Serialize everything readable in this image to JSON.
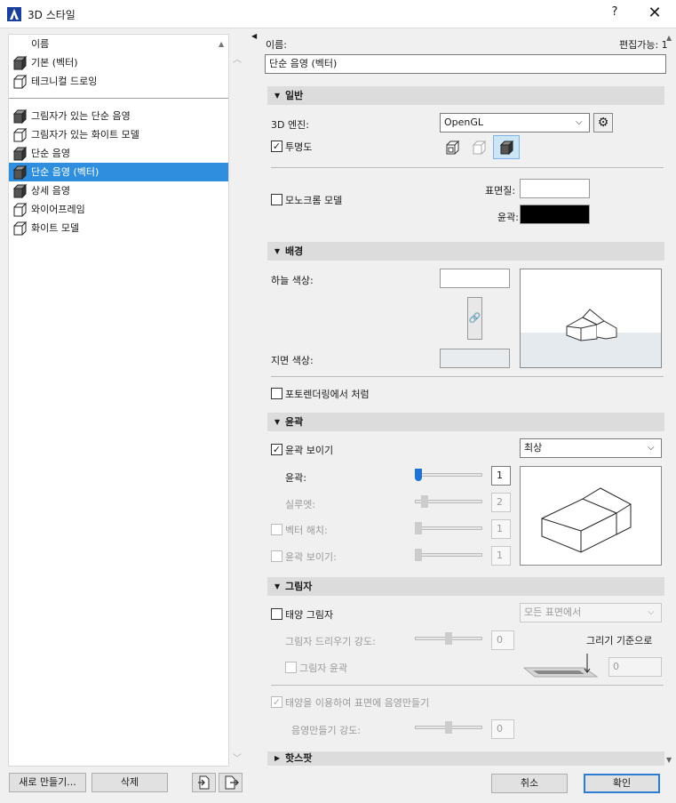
{
  "window": {
    "title": "3D 스타일",
    "help": "?",
    "close": "✕"
  },
  "list": {
    "header": "이름",
    "top_items": [
      "기본 (벡터)",
      "테크니컬 드로잉"
    ],
    "items": [
      "그림자가 있는 단순 음영",
      "그림자가 있는 화이트 모델",
      "단순 음영",
      "단순 음영 (벡터)",
      "상세 음영",
      "와이어프레임",
      "화이트 모델"
    ],
    "selected_index": 3
  },
  "left_buttons": {
    "new": "새로 만들기...",
    "delete": "삭제"
  },
  "name": {
    "label": "이름:",
    "editable": "편집가능: 1",
    "value": "단순 음영 (벡터)"
  },
  "general": {
    "title": "일반",
    "engine_label": "3D 엔진:",
    "engine_value": "OpenGL",
    "transparency_label": "투명도",
    "monochrome_label": "모노크롬 모델",
    "surface_label": "표면질:",
    "contour_label": "윤곽:"
  },
  "background": {
    "title": "배경",
    "sky_label": "하늘 색상:",
    "ground_label": "지면 색상:"
  },
  "photo_render_label": "포토렌더링에서 처럼",
  "contours": {
    "title": "윤곽",
    "show_label": "윤곽 보이기",
    "quality": "최상",
    "contour_label": "윤곽:",
    "contour_value": "1",
    "silhouette_label": "실루엣:",
    "silhouette_value": "2",
    "vector_hatch_label": "벡터 해치:",
    "vector_hatch_value": "1",
    "show2_label": "윤곽 보이기:",
    "show2_value": "1"
  },
  "shadows": {
    "title": "그림자",
    "sun_label": "태양 그림자",
    "surface_option": "모든 표면에서",
    "intensity_label": "그림자 드리우기 강도:",
    "intensity_value": "0",
    "draw_from": "그리기 기준으로",
    "outline_label": "그림자 윤곽",
    "level_value": "0",
    "sun_shading_label": "태양을 이용하여 표면에 음영만들기",
    "shading_intensity_label": "음영만들기 강도:",
    "shading_intensity_value": "0"
  },
  "hotspot": {
    "title": "핫스팟"
  },
  "footer": {
    "cancel": "취소",
    "ok": "확인"
  },
  "colors": {
    "accent": "#2f8fde",
    "section_bg": "#dcdcdc"
  }
}
